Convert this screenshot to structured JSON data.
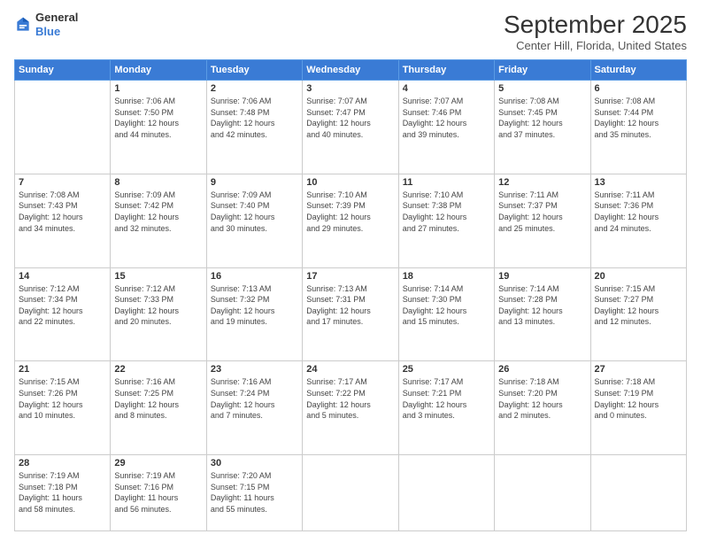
{
  "logo": {
    "general": "General",
    "blue": "Blue"
  },
  "header": {
    "month": "September 2025",
    "location": "Center Hill, Florida, United States"
  },
  "weekdays": [
    "Sunday",
    "Monday",
    "Tuesday",
    "Wednesday",
    "Thursday",
    "Friday",
    "Saturday"
  ],
  "weeks": [
    [
      {
        "day": "",
        "info": ""
      },
      {
        "day": "1",
        "info": "Sunrise: 7:06 AM\nSunset: 7:50 PM\nDaylight: 12 hours\nand 44 minutes."
      },
      {
        "day": "2",
        "info": "Sunrise: 7:06 AM\nSunset: 7:48 PM\nDaylight: 12 hours\nand 42 minutes."
      },
      {
        "day": "3",
        "info": "Sunrise: 7:07 AM\nSunset: 7:47 PM\nDaylight: 12 hours\nand 40 minutes."
      },
      {
        "day": "4",
        "info": "Sunrise: 7:07 AM\nSunset: 7:46 PM\nDaylight: 12 hours\nand 39 minutes."
      },
      {
        "day": "5",
        "info": "Sunrise: 7:08 AM\nSunset: 7:45 PM\nDaylight: 12 hours\nand 37 minutes."
      },
      {
        "day": "6",
        "info": "Sunrise: 7:08 AM\nSunset: 7:44 PM\nDaylight: 12 hours\nand 35 minutes."
      }
    ],
    [
      {
        "day": "7",
        "info": "Sunrise: 7:08 AM\nSunset: 7:43 PM\nDaylight: 12 hours\nand 34 minutes."
      },
      {
        "day": "8",
        "info": "Sunrise: 7:09 AM\nSunset: 7:42 PM\nDaylight: 12 hours\nand 32 minutes."
      },
      {
        "day": "9",
        "info": "Sunrise: 7:09 AM\nSunset: 7:40 PM\nDaylight: 12 hours\nand 30 minutes."
      },
      {
        "day": "10",
        "info": "Sunrise: 7:10 AM\nSunset: 7:39 PM\nDaylight: 12 hours\nand 29 minutes."
      },
      {
        "day": "11",
        "info": "Sunrise: 7:10 AM\nSunset: 7:38 PM\nDaylight: 12 hours\nand 27 minutes."
      },
      {
        "day": "12",
        "info": "Sunrise: 7:11 AM\nSunset: 7:37 PM\nDaylight: 12 hours\nand 25 minutes."
      },
      {
        "day": "13",
        "info": "Sunrise: 7:11 AM\nSunset: 7:36 PM\nDaylight: 12 hours\nand 24 minutes."
      }
    ],
    [
      {
        "day": "14",
        "info": "Sunrise: 7:12 AM\nSunset: 7:34 PM\nDaylight: 12 hours\nand 22 minutes."
      },
      {
        "day": "15",
        "info": "Sunrise: 7:12 AM\nSunset: 7:33 PM\nDaylight: 12 hours\nand 20 minutes."
      },
      {
        "day": "16",
        "info": "Sunrise: 7:13 AM\nSunset: 7:32 PM\nDaylight: 12 hours\nand 19 minutes."
      },
      {
        "day": "17",
        "info": "Sunrise: 7:13 AM\nSunset: 7:31 PM\nDaylight: 12 hours\nand 17 minutes."
      },
      {
        "day": "18",
        "info": "Sunrise: 7:14 AM\nSunset: 7:30 PM\nDaylight: 12 hours\nand 15 minutes."
      },
      {
        "day": "19",
        "info": "Sunrise: 7:14 AM\nSunset: 7:28 PM\nDaylight: 12 hours\nand 13 minutes."
      },
      {
        "day": "20",
        "info": "Sunrise: 7:15 AM\nSunset: 7:27 PM\nDaylight: 12 hours\nand 12 minutes."
      }
    ],
    [
      {
        "day": "21",
        "info": "Sunrise: 7:15 AM\nSunset: 7:26 PM\nDaylight: 12 hours\nand 10 minutes."
      },
      {
        "day": "22",
        "info": "Sunrise: 7:16 AM\nSunset: 7:25 PM\nDaylight: 12 hours\nand 8 minutes."
      },
      {
        "day": "23",
        "info": "Sunrise: 7:16 AM\nSunset: 7:24 PM\nDaylight: 12 hours\nand 7 minutes."
      },
      {
        "day": "24",
        "info": "Sunrise: 7:17 AM\nSunset: 7:22 PM\nDaylight: 12 hours\nand 5 minutes."
      },
      {
        "day": "25",
        "info": "Sunrise: 7:17 AM\nSunset: 7:21 PM\nDaylight: 12 hours\nand 3 minutes."
      },
      {
        "day": "26",
        "info": "Sunrise: 7:18 AM\nSunset: 7:20 PM\nDaylight: 12 hours\nand 2 minutes."
      },
      {
        "day": "27",
        "info": "Sunrise: 7:18 AM\nSunset: 7:19 PM\nDaylight: 12 hours\nand 0 minutes."
      }
    ],
    [
      {
        "day": "28",
        "info": "Sunrise: 7:19 AM\nSunset: 7:18 PM\nDaylight: 11 hours\nand 58 minutes."
      },
      {
        "day": "29",
        "info": "Sunrise: 7:19 AM\nSunset: 7:16 PM\nDaylight: 11 hours\nand 56 minutes."
      },
      {
        "day": "30",
        "info": "Sunrise: 7:20 AM\nSunset: 7:15 PM\nDaylight: 11 hours\nand 55 minutes."
      },
      {
        "day": "",
        "info": ""
      },
      {
        "day": "",
        "info": ""
      },
      {
        "day": "",
        "info": ""
      },
      {
        "day": "",
        "info": ""
      }
    ]
  ]
}
